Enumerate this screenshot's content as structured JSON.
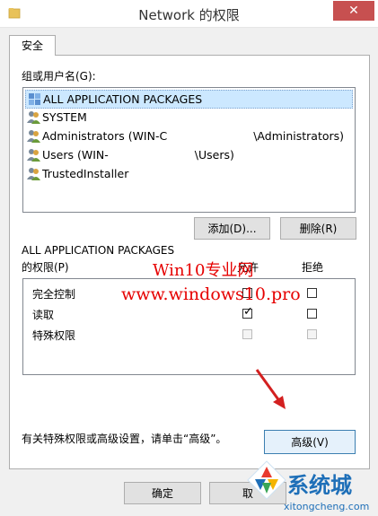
{
  "window": {
    "title": "Network 的权限",
    "close_glyph": "✕"
  },
  "tab": {
    "label": "安全"
  },
  "group_label": "组或用户名(G):",
  "principals": [
    {
      "name": "ALL APPLICATION PACKAGES",
      "icon": "app-packages-icon",
      "selected": true
    },
    {
      "name": "SYSTEM",
      "icon": "user-group-icon"
    },
    {
      "name_prefix": "Administrators (WIN-C",
      "name_suffix": "\\Administrators)",
      "icon": "user-group-icon"
    },
    {
      "name_prefix": "Users (WIN-",
      "name_suffix": "\\Users)",
      "icon": "user-group-icon"
    },
    {
      "name": "TrustedInstaller",
      "icon": "user-group-icon"
    }
  ],
  "buttons": {
    "add": "添加(D)...",
    "remove": "删除(R)",
    "advanced": "高级(V)",
    "ok": "确定",
    "cancel": "取"
  },
  "permissions_for": "ALL APPLICATION PACKAGES",
  "permissions_label": "的权限(P)",
  "columns": {
    "allow": "允许",
    "deny": "拒绝"
  },
  "permissions": [
    {
      "name": "完全控制",
      "allow": false,
      "deny": false,
      "disabled": false
    },
    {
      "name": "读取",
      "allow": true,
      "deny": false,
      "disabled": false
    },
    {
      "name": "特殊权限",
      "allow": false,
      "deny": false,
      "disabled": true
    }
  ],
  "advanced_hint": "有关特殊权限或高级设置，请单击“高级”。",
  "watermark": {
    "line1": "Win10专业网",
    "line2": "www.windows10.pro"
  },
  "logo": {
    "brand": "系统城",
    "url": "xitongcheng.com"
  },
  "colors": {
    "accent": "#3c7fb1",
    "close": "#c75050",
    "watermark": "#e60000",
    "arrow": "#d32020",
    "logo": "#1e6fb8"
  }
}
